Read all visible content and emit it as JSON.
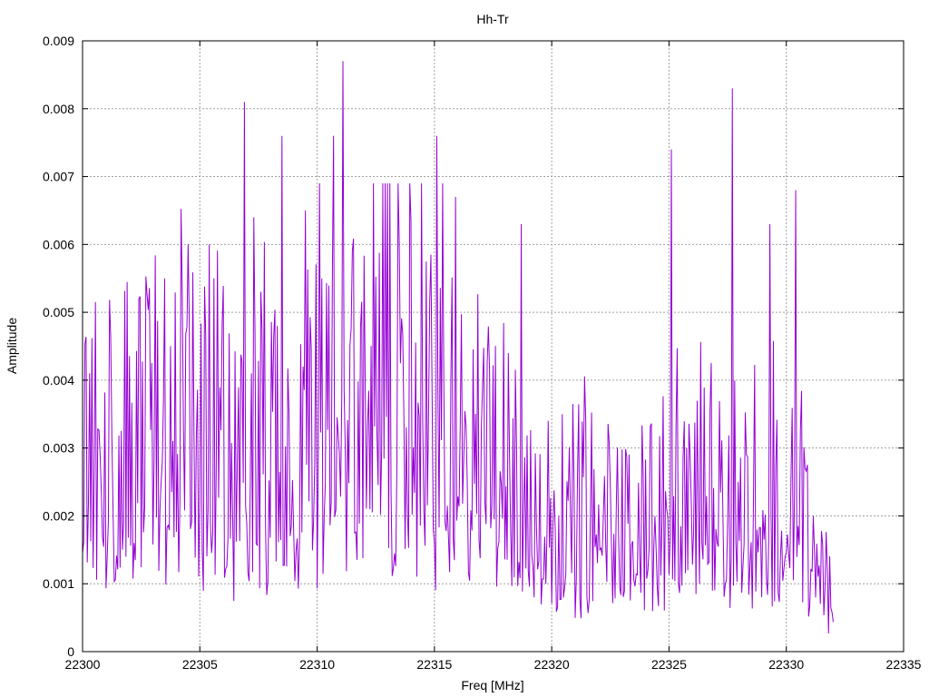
{
  "chart_data": {
    "type": "line",
    "title": "Hh-Tr",
    "xlabel": "Freq [MHz]",
    "ylabel": "Amplitude",
    "xlim": [
      22300,
      22335
    ],
    "ylim": [
      0,
      0.009
    ],
    "grid": true,
    "legend": "none",
    "x_ticks": [
      "22300",
      "22305",
      "22310",
      "22315",
      "22320",
      "22325",
      "22330",
      "22335"
    ],
    "y_ticks": [
      "0",
      "0.001",
      "0.002",
      "0.003",
      "0.004",
      "0.005",
      "0.006",
      "0.007",
      "0.008",
      "0.009"
    ],
    "series": [
      {
        "color": "#9400d3",
        "x_start": 22300.0,
        "x_step": 0.05,
        "peaks": [
          {
            "x": 22300.3,
            "y": 0.0041
          },
          {
            "x": 22302.4,
            "y": 0.0052
          },
          {
            "x": 22303.5,
            "y": 0.0055
          },
          {
            "x": 22304.5,
            "y": 0.006
          },
          {
            "x": 22305.4,
            "y": 0.006
          },
          {
            "x": 22306.9,
            "y": 0.0081
          },
          {
            "x": 22307.3,
            "y": 0.0064
          },
          {
            "x": 22308.5,
            "y": 0.0076
          },
          {
            "x": 22309.5,
            "y": 0.0065
          },
          {
            "x": 22310.7,
            "y": 0.0076
          },
          {
            "x": 22311.1,
            "y": 0.0087
          },
          {
            "x": 22315.1,
            "y": 0.0076
          },
          {
            "x": 22315.9,
            "y": 0.0067
          },
          {
            "x": 22318.7,
            "y": 0.0063
          },
          {
            "x": 22325.1,
            "y": 0.0074
          },
          {
            "x": 22327.7,
            "y": 0.0083
          },
          {
            "x": 22329.3,
            "y": 0.0063
          },
          {
            "x": 22330.4,
            "y": 0.0068
          }
        ],
        "values_end": 22332.0
      }
    ]
  }
}
